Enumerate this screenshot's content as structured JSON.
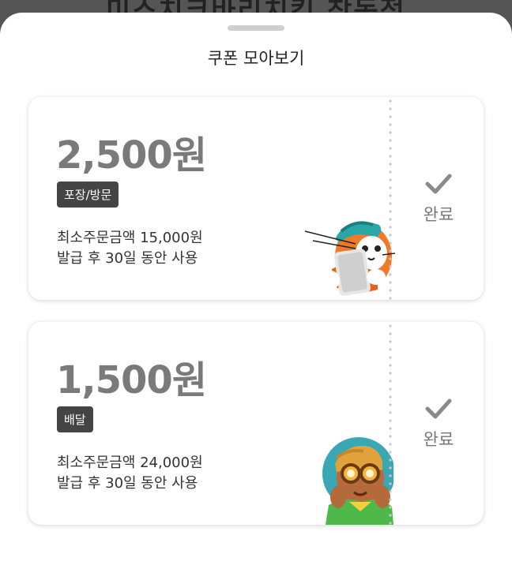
{
  "backdrop": {
    "title": "미스치크바리치킨 창동점"
  },
  "sheet": {
    "title": "쿠폰 모아보기"
  },
  "coupons": [
    {
      "amount": "2,500원",
      "badge": "포장/방문",
      "min_order": "최소주문금액 15,000원",
      "validity": "발급 후 30일 동안 사용",
      "status": "완료",
      "icon": "check-icon",
      "illustration": "cat-with-tablet-illustration"
    },
    {
      "amount": "1,500원",
      "badge": "배달",
      "min_order": "최소주문금액 24,000원",
      "validity": "발급 후 30일 동안 사용",
      "status": "완료",
      "icon": "check-icon",
      "illustration": "person-with-goggles-illustration"
    }
  ],
  "colors": {
    "accent_amount": "#7a7a7a",
    "badge_bg": "#444444",
    "status": "#777777"
  }
}
